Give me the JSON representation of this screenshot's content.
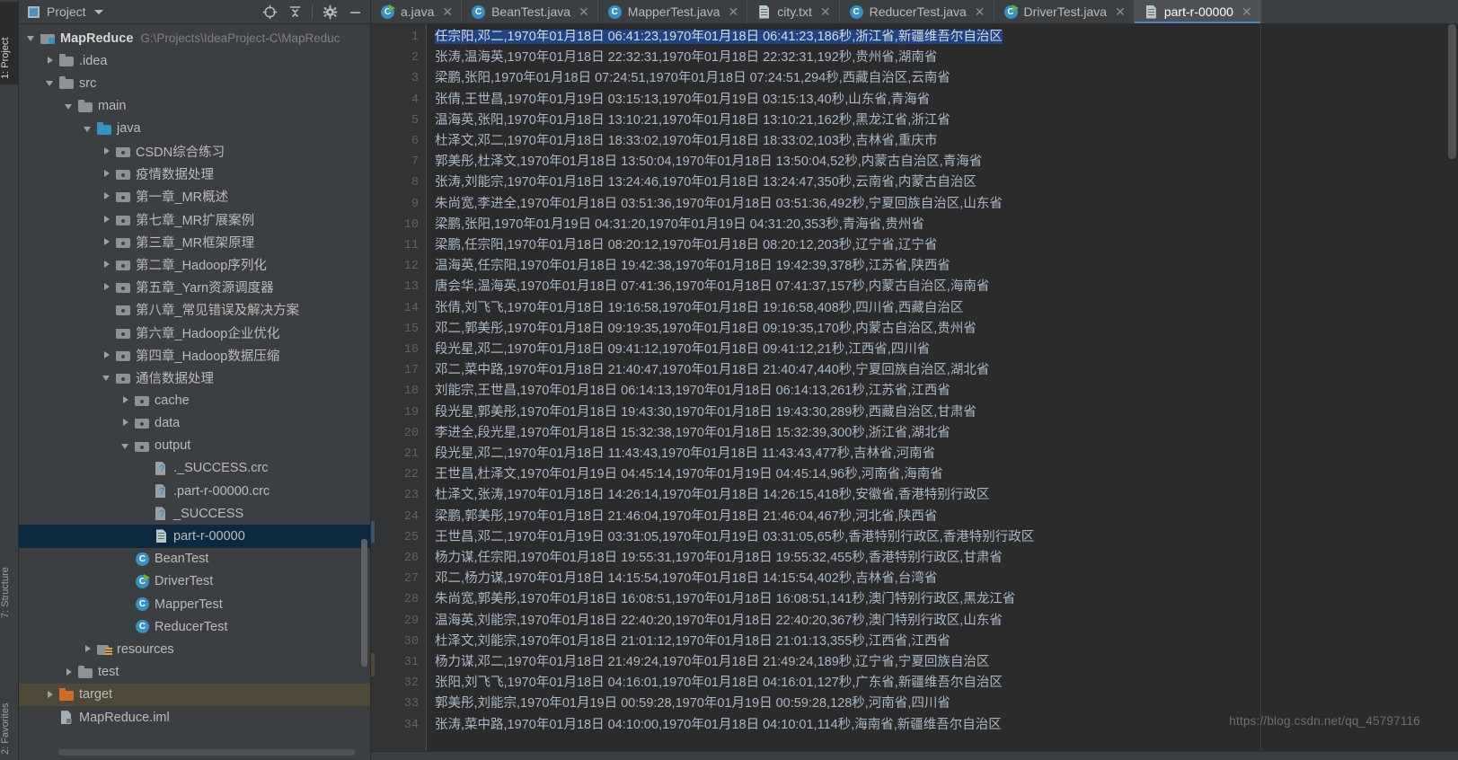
{
  "window": {
    "tool_tabs_left": [
      "1: Project",
      "7: Structure",
      "2: Favorites"
    ]
  },
  "project_panel": {
    "title": "Project",
    "icons": [
      "project-square-icon",
      "chevron-down-icon",
      "locate-icon",
      "collapse-all-icon",
      "gear-icon",
      "minimize-icon"
    ],
    "tree": [
      {
        "depth": 0,
        "twist": "open",
        "icon": "modfolder",
        "label": "MapReduce",
        "bold": true,
        "path": "G:\\Projects\\IdeaProject-C\\MapReduc"
      },
      {
        "depth": 1,
        "twist": "closed",
        "icon": "folder",
        "label": ".idea"
      },
      {
        "depth": 1,
        "twist": "open",
        "icon": "folder",
        "label": "src"
      },
      {
        "depth": 2,
        "twist": "open",
        "icon": "folder",
        "label": "main"
      },
      {
        "depth": 3,
        "twist": "open",
        "icon": "srcfolder",
        "label": "java"
      },
      {
        "depth": 4,
        "twist": "closed",
        "icon": "pkgfolder",
        "label": "CSDN综合练习"
      },
      {
        "depth": 4,
        "twist": "closed",
        "icon": "pkgfolder",
        "label": "疫情数据处理"
      },
      {
        "depth": 4,
        "twist": "closed",
        "icon": "pkgfolder",
        "label": "第一章_MR概述"
      },
      {
        "depth": 4,
        "twist": "closed",
        "icon": "pkgfolder",
        "label": "第七章_MR扩展案例"
      },
      {
        "depth": 4,
        "twist": "closed",
        "icon": "pkgfolder",
        "label": "第三章_MR框架原理"
      },
      {
        "depth": 4,
        "twist": "closed",
        "icon": "pkgfolder",
        "label": "第二章_Hadoop序列化"
      },
      {
        "depth": 4,
        "twist": "closed",
        "icon": "pkgfolder",
        "label": "第五章_Yarn资源调度器"
      },
      {
        "depth": 4,
        "twist": "none",
        "icon": "pkgfolder",
        "label": "第八章_常见错误及解决方案"
      },
      {
        "depth": 4,
        "twist": "none",
        "icon": "pkgfolder",
        "label": "第六章_Hadoop企业优化"
      },
      {
        "depth": 4,
        "twist": "closed",
        "icon": "pkgfolder",
        "label": "第四章_Hadoop数据压缩"
      },
      {
        "depth": 4,
        "twist": "open",
        "icon": "pkgfolder",
        "label": "通信数据处理"
      },
      {
        "depth": 5,
        "twist": "closed",
        "icon": "pkgfolder",
        "label": "cache"
      },
      {
        "depth": 5,
        "twist": "closed",
        "icon": "pkgfolder",
        "label": "data"
      },
      {
        "depth": 5,
        "twist": "open",
        "icon": "pkgfolder",
        "label": "output"
      },
      {
        "depth": 6,
        "twist": "none",
        "icon": "unkfile",
        "label": "._SUCCESS.crc"
      },
      {
        "depth": 6,
        "twist": "none",
        "icon": "unkfile",
        "label": ".part-r-00000.crc"
      },
      {
        "depth": 6,
        "twist": "none",
        "icon": "unkfile",
        "label": "_SUCCESS"
      },
      {
        "depth": 6,
        "twist": "none",
        "icon": "txtfile",
        "label": "part-r-00000",
        "selected": true
      },
      {
        "depth": 5,
        "twist": "none",
        "icon": "classj",
        "label": "BeanTest"
      },
      {
        "depth": 5,
        "twist": "none",
        "icon": "classj-run",
        "label": "DriverTest"
      },
      {
        "depth": 5,
        "twist": "none",
        "icon": "classj",
        "label": "MapperTest"
      },
      {
        "depth": 5,
        "twist": "none",
        "icon": "classj",
        "label": "ReducerTest"
      },
      {
        "depth": 3,
        "twist": "closed",
        "icon": "resfolder",
        "label": "resources"
      },
      {
        "depth": 2,
        "twist": "closed",
        "icon": "folder",
        "label": "test"
      },
      {
        "depth": 1,
        "twist": "closed",
        "icon": "tgtfolder",
        "label": "target",
        "highlight": true
      },
      {
        "depth": 1,
        "twist": "none",
        "icon": "imlfile",
        "label": "MapReduce.iml"
      }
    ]
  },
  "editor": {
    "tabs": [
      {
        "label": "a.java",
        "icon": "java-class-run-icon",
        "active": false
      },
      {
        "label": "BeanTest.java",
        "icon": "java-class-icon",
        "active": false
      },
      {
        "label": "MapperTest.java",
        "icon": "java-class-icon",
        "active": false
      },
      {
        "label": "city.txt",
        "icon": "text-file-icon",
        "active": false
      },
      {
        "label": "ReducerTest.java",
        "icon": "java-class-icon",
        "active": false
      },
      {
        "label": "DriverTest.java",
        "icon": "java-class-run-icon",
        "active": false
      },
      {
        "label": "part-r-00000",
        "icon": "text-file-icon",
        "active": true
      }
    ],
    "close_glyph": "✕",
    "first_line_number": 1,
    "last_line_number": 34,
    "selected_line": 1,
    "lines": [
      "任宗阳,邓二,1970年01月18日  06:41:23,1970年01月18日  06:41:23,186秒,浙江省,新疆维吾尔自治区",
      "张涛,温海英,1970年01月18日  22:32:31,1970年01月18日  22:32:31,192秒,贵州省,湖南省",
      "梁鹏,张阳,1970年01月18日  07:24:51,1970年01月18日  07:24:51,294秒,西藏自治区,云南省",
      "张倩,王世昌,1970年01月19日  03:15:13,1970年01月19日  03:15:13,40秒,山东省,青海省",
      "温海英,张阳,1970年01月18日  13:10:21,1970年01月18日  13:10:21,162秒,黑龙江省,浙江省",
      "杜泽文,邓二,1970年01月18日  18:33:02,1970年01月18日  18:33:02,103秒,吉林省,重庆市",
      "郭美彤,杜泽文,1970年01月18日  13:50:04,1970年01月18日  13:50:04,52秒,内蒙古自治区,青海省",
      "张涛,刘能宗,1970年01月18日  13:24:46,1970年01月18日  13:24:47,350秒,云南省,内蒙古自治区",
      "朱尚宽,李进全,1970年01月18日  03:51:36,1970年01月18日  03:51:36,492秒,宁夏回族自治区,山东省",
      "梁鹏,张阳,1970年01月19日  04:31:20,1970年01月19日  04:31:20,353秒,青海省,贵州省",
      "梁鹏,任宗阳,1970年01月18日  08:20:12,1970年01月18日  08:20:12,203秒,辽宁省,辽宁省",
      "温海英,任宗阳,1970年01月18日  19:42:38,1970年01月18日  19:42:39,378秒,江苏省,陕西省",
      "唐会华,温海英,1970年01月18日  07:41:36,1970年01月18日  07:41:37,157秒,内蒙古自治区,海南省",
      "张倩,刘飞飞,1970年01月18日  19:16:58,1970年01月18日  19:16:58,408秒,四川省,西藏自治区",
      "邓二,郭美彤,1970年01月18日  09:19:35,1970年01月18日  09:19:35,170秒,内蒙古自治区,贵州省",
      "段光星,邓二,1970年01月18日  09:41:12,1970年01月18日  09:41:12,21秒,江西省,四川省",
      "邓二,菜中路,1970年01月18日  21:40:47,1970年01月18日  21:40:47,440秒,宁夏回族自治区,湖北省",
      "刘能宗,王世昌,1970年01月18日  06:14:13,1970年01月18日  06:14:13,261秒,江苏省,江西省",
      "段光星,郭美彤,1970年01月18日  19:43:30,1970年01月18日  19:43:30,289秒,西藏自治区,甘肃省",
      "李进全,段光星,1970年01月18日  15:32:38,1970年01月18日  15:32:39,300秒,浙江省,湖北省",
      "段光星,邓二,1970年01月18日  11:43:43,1970年01月18日  11:43:43,477秒,吉林省,河南省",
      "王世昌,杜泽文,1970年01月19日  04:45:14,1970年01月19日  04:45:14,96秒,河南省,海南省",
      "杜泽文,张涛,1970年01月18日  14:26:14,1970年01月18日  14:26:15,418秒,安徽省,香港特别行政区",
      "梁鹏,郭美彤,1970年01月18日  21:46:04,1970年01月18日  21:46:04,467秒,河北省,陕西省",
      "王世昌,邓二,1970年01月19日  03:31:05,1970年01月19日  03:31:05,65秒,香港特别行政区,香港特别行政区",
      "杨力谋,任宗阳,1970年01月18日  19:55:31,1970年01月18日  19:55:32,455秒,香港特别行政区,甘肃省",
      "邓二,杨力谋,1970年01月18日  14:15:54,1970年01月18日  14:15:54,402秒,吉林省,台湾省",
      "朱尚宽,郭美彤,1970年01月18日  16:08:51,1970年01月18日  16:08:51,141秒,澳门特别行政区,黑龙江省",
      "温海英,刘能宗,1970年01月18日  22:40:20,1970年01月18日  22:40:20,367秒,澳门特别行政区,山东省",
      "杜泽文,刘能宗,1970年01月18日  21:01:12,1970年01月18日  21:01:13,355秒,江西省,江西省",
      "杨力谋,邓二,1970年01月18日  21:49:24,1970年01月18日  21:49:24,189秒,辽宁省,宁夏回族自治区",
      "张阳,刘飞飞,1970年01月18日  04:16:01,1970年01月18日  04:16:01,127秒,广东省,新疆维吾尔自治区",
      "郭美彤,刘能宗,1970年01月19日  00:59:28,1970年01月19日  00:59:28,128秒,河南省,四川省",
      "张涛,菜中路,1970年01月18日  04:10:00,1970年01月18日  04:10:01,114秒,海南省,新疆维吾尔自治区"
    ],
    "watermark": "https://blog.csdn.net/qq_45797116"
  },
  "colors": {
    "panel_bg": "#3c3f41",
    "editor_bg": "#2b2b2b",
    "gutter_bg": "#313335",
    "selection_blue": "#214283",
    "tree_selected": "#0d293e",
    "accent_blue": "#3592c4",
    "text": "#a9b7c6",
    "muted": "#808080",
    "target_highlight": "#4e4a37",
    "run_green": "#62b543",
    "orange_folder": "#cc6e28"
  }
}
